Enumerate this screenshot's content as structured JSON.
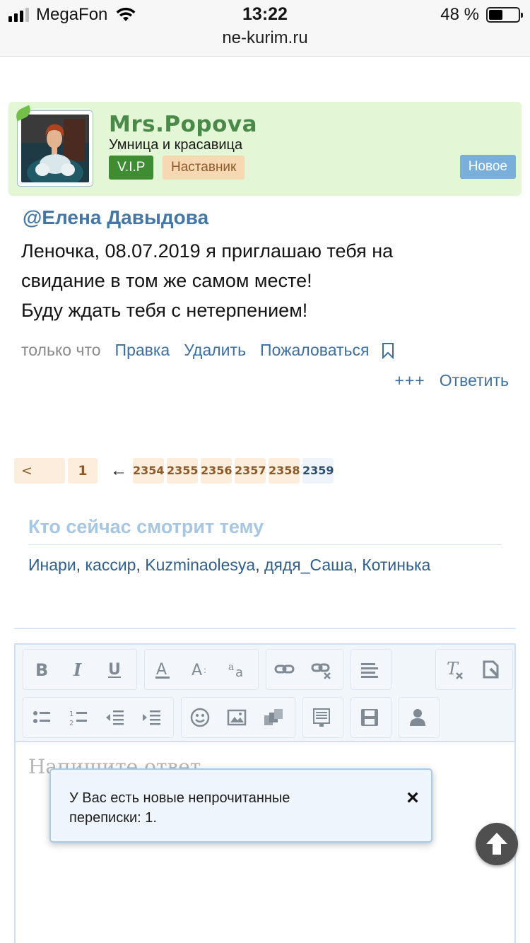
{
  "status_bar": {
    "carrier": "MegaFon",
    "time": "13:22",
    "url": "ne-kurim.ru",
    "battery_text": "48 %",
    "battery_level": 0.48
  },
  "post": {
    "username": "Mrs.Popova",
    "user_title": "Умница и красавица",
    "badge_vip": "V.I.P",
    "badge_mentor": "Наставник",
    "badge_new": "Новое",
    "mention": "@Елена Давыдова",
    "message_lines": [
      "Леночка, 08.07.2019 я приглашаю тебя на",
      "свидание в том же самом месте!",
      "Буду ждать тебя с нетерпением!"
    ],
    "timestamp": "только что",
    "actions": {
      "edit": "Правка",
      "delete": "Удалить",
      "report": "Пожаловаться"
    },
    "plus": "+++",
    "reply": "Ответить"
  },
  "pagination": {
    "prev": "<",
    "first": "1",
    "arrow": "←",
    "pages": [
      "2354",
      "2355",
      "2356",
      "2357",
      "2358",
      "2359"
    ],
    "current": "2359"
  },
  "viewers": {
    "title": "Кто сейчас смотрит тему",
    "names": [
      "Инари",
      "кассир",
      "Kuzminaolesya",
      "дядя_Саша",
      "Котинька"
    ],
    "separator": ", "
  },
  "editor": {
    "placeholder": "Напишите ответ...",
    "toolbar_row1": [
      "bold-icon",
      "italic-icon",
      "underline-icon",
      "text-color-icon",
      "font-size-icon",
      "font-family-icon",
      "link-icon",
      "unlink-icon",
      "align-icon",
      "remove-format-icon",
      "source-icon"
    ],
    "toolbar_row2": [
      "bulleted-list-icon",
      "numbered-list-icon",
      "outdent-icon",
      "indent-icon",
      "smiley-icon",
      "image-icon",
      "media-icon",
      "template-icon",
      "save-draft-icon",
      "user-icon"
    ]
  },
  "notice": {
    "line1": "У Вас есть новые непрочитанные",
    "line2": "переписки: 1.",
    "close": "×"
  },
  "colors": {
    "card_bg": "#e3f7d7",
    "username": "#4a8a49",
    "link": "#3d6fa0",
    "vip": "#3e8d33",
    "mentor_bg": "#f6d9b2",
    "new_bg": "#7aaedb",
    "pager_bg": "#fdeddc"
  }
}
